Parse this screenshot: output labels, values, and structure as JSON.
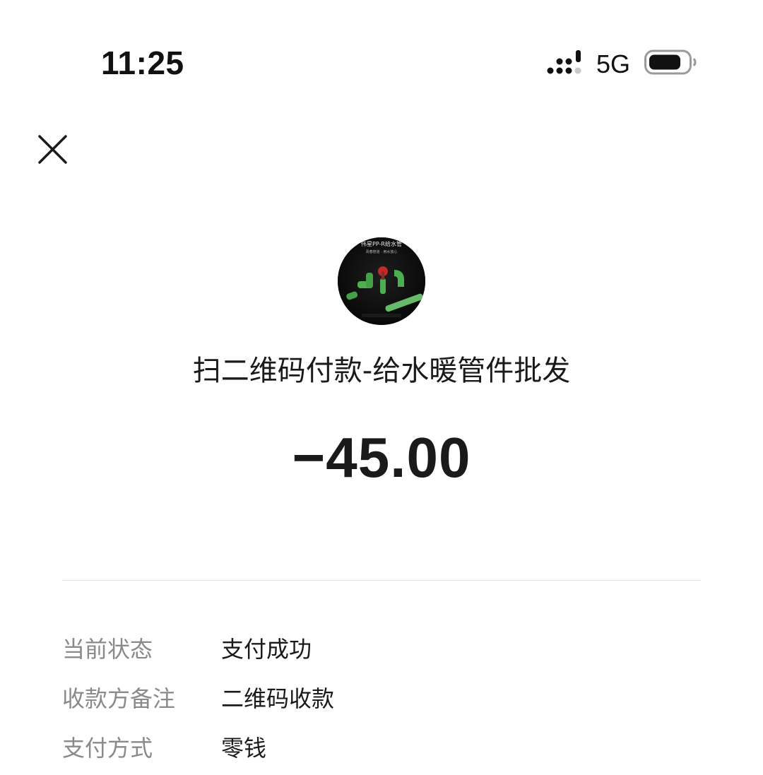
{
  "status_bar": {
    "time": "11:25",
    "network": "5G",
    "signal_icon": "signal-bars-icon",
    "battery_icon": "battery-icon"
  },
  "header": {
    "close_icon": "close-icon"
  },
  "merchant": {
    "avatar_icon": "merchant-avatar",
    "avatar_text_line1": "伟星PP-R给水管",
    "avatar_text_line2": "青春管道 · 用水放心",
    "name": "扫二维码付款-给水暖管件批发"
  },
  "transaction": {
    "amount": "−45.00"
  },
  "details": [
    {
      "label": "当前状态",
      "value": "支付成功"
    },
    {
      "label": "收款方备注",
      "value": "二维码收款"
    },
    {
      "label": "支付方式",
      "value": "零钱"
    }
  ],
  "colors": {
    "background": "#ffffff",
    "text_primary": "#1a1a1a",
    "text_secondary": "#8a8a8a",
    "divider": "#e6e6e6",
    "pipe_green": "#4caf50"
  }
}
